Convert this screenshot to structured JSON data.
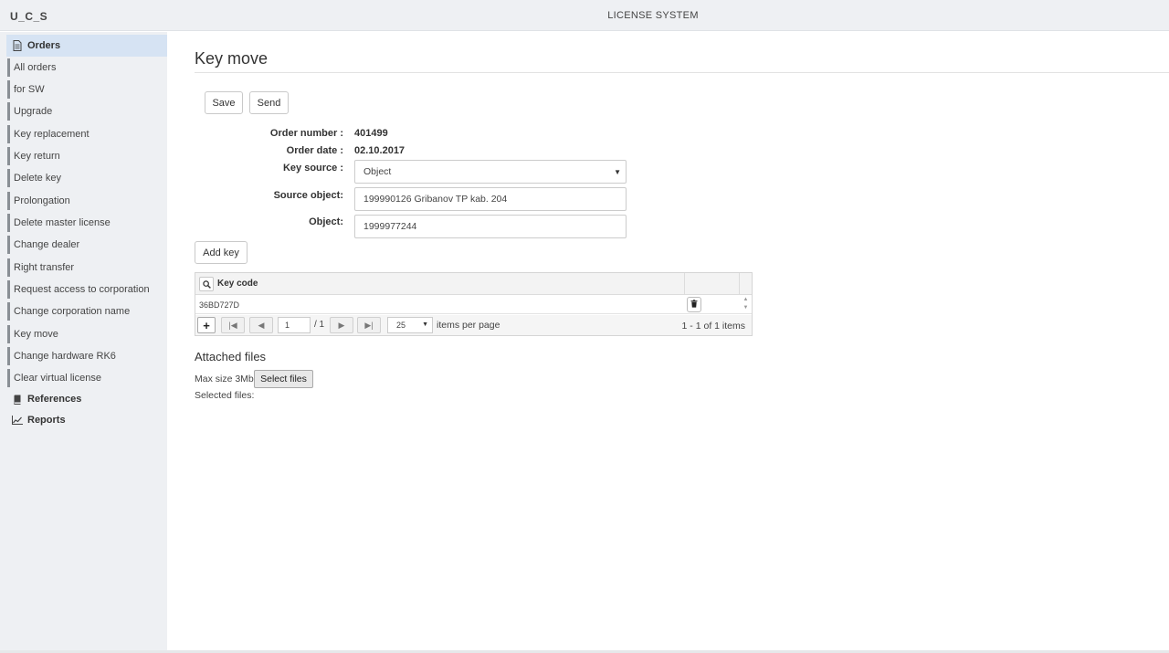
{
  "header": {
    "brand": "U_C_S",
    "title": "LICENSE SYSTEM"
  },
  "sidebar": {
    "orders_label": "Orders",
    "items": [
      {
        "label": "All orders"
      },
      {
        "label": "for SW"
      },
      {
        "label": "Upgrade"
      },
      {
        "label": "Key replacement"
      },
      {
        "label": "Key return"
      },
      {
        "label": "Delete key"
      },
      {
        "label": "Prolongation"
      },
      {
        "label": "Delete master license"
      },
      {
        "label": "Change dealer"
      },
      {
        "label": "Right transfer"
      },
      {
        "label": "Request access to corporation"
      },
      {
        "label": "Change corporation name"
      },
      {
        "label": "Key move"
      },
      {
        "label": "Change hardware RK6"
      },
      {
        "label": "Clear virtual license"
      }
    ],
    "references_label": "References",
    "reports_label": "Reports"
  },
  "main": {
    "title": "Key move",
    "save_label": "Save",
    "send_label": "Send",
    "form": {
      "order_number_label": "Order number :",
      "order_number_value": "401499",
      "order_date_label": "Order date :",
      "order_date_value": "02.10.2017",
      "key_source_label": "Key source :",
      "key_source_value": "Object",
      "source_object_label": "Source object:",
      "source_object_value": "199990126 Gribanov TP kab. 204",
      "object_label": "Object:",
      "object_value": "1999977244"
    },
    "add_key_label": "Add key",
    "grid": {
      "column_header": "Key code",
      "rows": [
        {
          "key_code": "36BD727D"
        }
      ],
      "page_value": "1",
      "page_of": "/ 1",
      "page_size": "25",
      "items_per_page": "items per page",
      "info": "1 - 1 of 1 items"
    },
    "attached": {
      "title": "Attached files",
      "max_size": "Max size 3Mb",
      "select_files": "Select files",
      "selected_files": "Selected files:"
    }
  }
}
